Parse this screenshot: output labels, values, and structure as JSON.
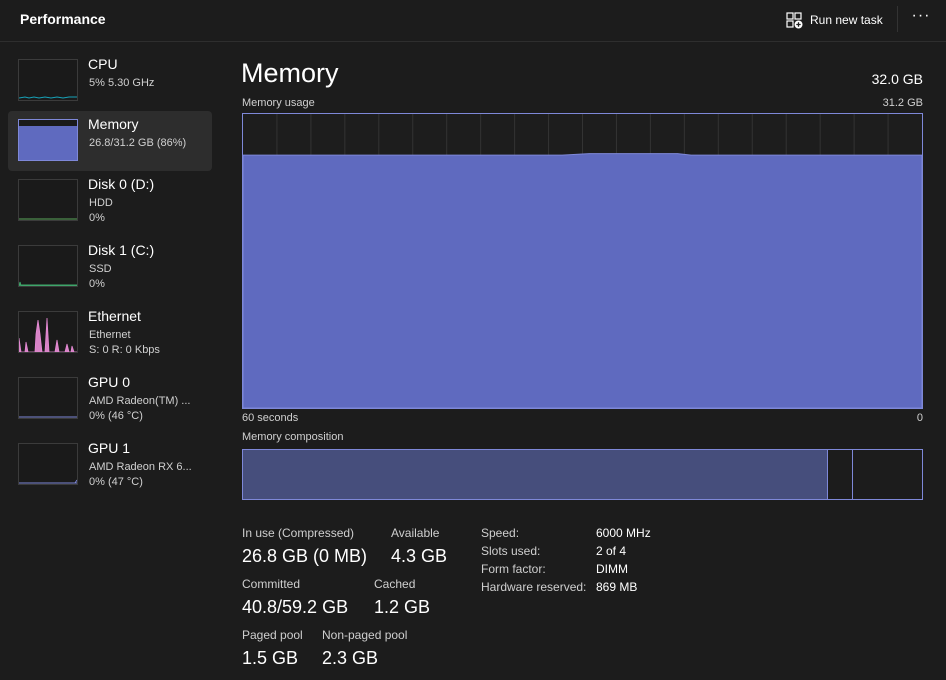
{
  "header": {
    "title": "Performance",
    "run_task_label": "Run new task",
    "more_label": "···"
  },
  "sidebar": {
    "items": [
      {
        "name": "CPU",
        "line1": "5%  5.30 GHz",
        "line2": ""
      },
      {
        "name": "Memory",
        "line1": "26.8/31.2 GB (86%)",
        "line2": ""
      },
      {
        "name": "Disk 0 (D:)",
        "line1": "HDD",
        "line2": "0%"
      },
      {
        "name": "Disk 1 (C:)",
        "line1": "SSD",
        "line2": "0%"
      },
      {
        "name": "Ethernet",
        "line1": "Ethernet",
        "line2": "S: 0  R: 0 Kbps"
      },
      {
        "name": "GPU 0",
        "line1": "AMD Radeon(TM) ...",
        "line2": "0%  (46 °C)"
      },
      {
        "name": "GPU 1",
        "line1": "AMD Radeon RX 6...",
        "line2": "0%  (47 °C)"
      }
    ]
  },
  "main": {
    "title": "Memory",
    "total": "32.0 GB",
    "usage_label": "Memory usage",
    "usage_max": "31.2 GB",
    "time_left": "60 seconds",
    "time_right": "0",
    "composition_label": "Memory composition",
    "composition": {
      "in_use_fraction": 0.86,
      "modified_fraction": 0.037
    },
    "graph": {
      "used_fraction": 0.86
    }
  },
  "stats": {
    "in_use_label": "In use (Compressed)",
    "in_use_value": "26.8 GB (0 MB)",
    "available_label": "Available",
    "available_value": "4.3 GB",
    "committed_label": "Committed",
    "committed_value": "40.8/59.2 GB",
    "cached_label": "Cached",
    "cached_value": "1.2 GB",
    "paged_label": "Paged pool",
    "paged_value": "1.5 GB",
    "nonpaged_label": "Non-paged pool",
    "nonpaged_value": "2.3 GB"
  },
  "specs": [
    {
      "key": "Speed:",
      "value": "6000 MHz"
    },
    {
      "key": "Slots used:",
      "value": "2 of 4"
    },
    {
      "key": "Form factor:",
      "value": "DIMM"
    },
    {
      "key": "Hardware reserved:",
      "value": "869 MB"
    }
  ],
  "colors": {
    "memory_fill": "#5f6abf",
    "memory_line": "#7e88d8",
    "ethernet": "#e58ad4",
    "cpu": "#17a2b8",
    "gpu": "#7e88d8"
  }
}
